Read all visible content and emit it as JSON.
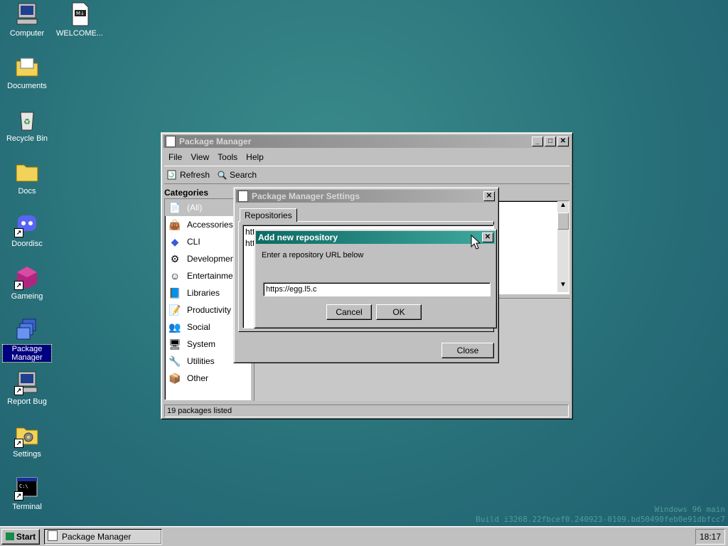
{
  "desktop": {
    "icons": [
      {
        "label": "Computer"
      },
      {
        "label": "WELCOME..."
      },
      {
        "label": "Documents"
      },
      {
        "label": "Recycle Bin"
      },
      {
        "label": "Docs"
      },
      {
        "label": "Doordisc"
      },
      {
        "label": "Gameing"
      },
      {
        "label": "Package Manager"
      },
      {
        "label": "Report Bug"
      },
      {
        "label": "Settings"
      },
      {
        "label": "Terminal"
      }
    ],
    "watermark_line1": "Windows 96 main",
    "watermark_line2": "Build i3268.22fbcef0.240923-0109.bd50490feb0e91dbfcc7"
  },
  "package_manager": {
    "title": "Package Manager",
    "menu": [
      "File",
      "View",
      "Tools",
      "Help"
    ],
    "toolbar": {
      "refresh": "Refresh",
      "search": "Search"
    },
    "categories_header": "Categories",
    "categories": [
      "(All)",
      "Accessories",
      "CLI",
      "Development",
      "Entertainment",
      "Libraries",
      "Productivity",
      "Social",
      "System",
      "Utilities",
      "Other"
    ],
    "status": "19 packages listed"
  },
  "settings_dialog": {
    "title": "Package Manager Settings",
    "tab": "Repositories",
    "repo_rows": [
      "htt",
      "htt"
    ],
    "close_button": "Close"
  },
  "add_repo_dialog": {
    "title": "Add new repository",
    "prompt": "Enter a repository URL below",
    "url_value": "https://egg.l5.c",
    "cancel_button": "Cancel",
    "ok_button": "OK"
  },
  "taskbar": {
    "start_label": "Start",
    "task_label": "Package Manager",
    "clock": "18:17"
  },
  "colors": {
    "desktop": "#2f7b80",
    "active_title": "#0d6a64",
    "inactive_title": "#808080",
    "selection": "#000080"
  }
}
